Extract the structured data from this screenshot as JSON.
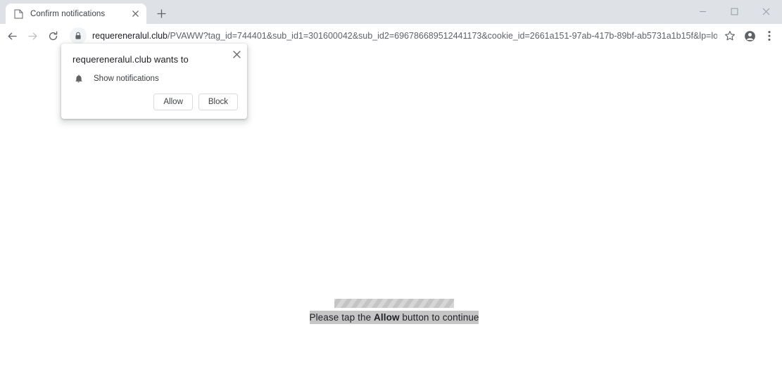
{
  "window": {
    "controls": [
      {
        "name": "minimize",
        "glyph": "minimize-icon"
      },
      {
        "name": "maximize",
        "glyph": "maximize-icon"
      },
      {
        "name": "close",
        "glyph": "close-icon"
      }
    ]
  },
  "tabstrip": {
    "tabs": [
      {
        "title": "Confirm notifications",
        "favicon": "page-icon",
        "close_label": "close-tab-icon",
        "active": true
      }
    ],
    "new_tab_label": "new-tab-icon"
  },
  "toolbar": {
    "back_icon": "back-arrow-icon",
    "forward_icon": "forward-arrow-icon",
    "reload_icon": "reload-icon",
    "lock_icon": "lock-icon",
    "url": {
      "host": "requereneralul.club",
      "rest": "/PVAWW?tag_id=744401&sub_id1=301600042&sub_id2=696786689512441173&cookie_id=2661a151-97ab-417b-89bf-ab5731a1b15f&lp=loading&tb=redir...",
      "full": "requereneralul.club/PVAWW?tag_id=744401&sub_id1=301600042&sub_id2=696786689512441173&cookie_id=2661a151-97ab-417b-89bf-ab5731a1b15f&lp=loading&tb=redir..."
    },
    "bookmark_icon": "star-icon",
    "profile_icon": "profile-avatar-icon",
    "menu_icon": "three-dot-menu-icon"
  },
  "permission_dialog": {
    "title": "requereneralul.club wants to",
    "permission_icon": "bell-icon",
    "permission_label": "Show notifications",
    "allow_label": "Allow",
    "block_label": "Block",
    "close_label": "close-icon"
  },
  "page": {
    "progress_label": "loading-progress-bar",
    "message_prefix": "Please tap the ",
    "message_emphasis": "Allow",
    "message_suffix": " button to continue"
  },
  "colors": {
    "tabstrip_bg": "#dee1e6",
    "toolbar_bg": "#ffffff",
    "page_bg": "#ffffff",
    "text_primary": "#202124",
    "text_secondary": "#5f6368",
    "dialog_border": "#dadce0",
    "highlight_band": "#c6c6c6",
    "progress_stripe": "#d6d6d6"
  }
}
